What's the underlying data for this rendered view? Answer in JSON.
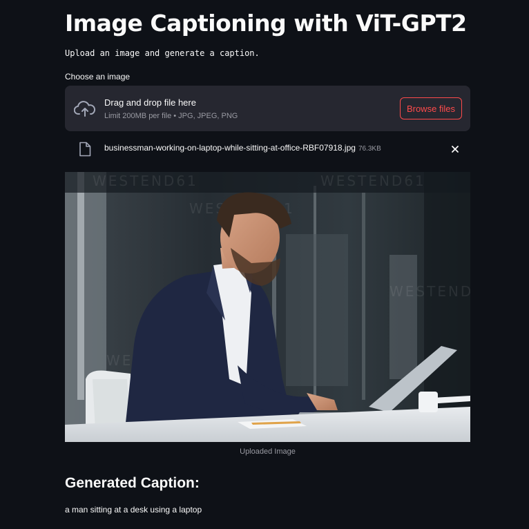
{
  "page": {
    "title": "Image Captioning with ViT-GPT2",
    "subtitle": "Upload an image and generate a caption."
  },
  "uploader": {
    "label": "Choose an image",
    "drop_text": "Drag and drop file here",
    "limit_text": "Limit 200MB per file • JPG, JPEG, PNG",
    "browse_label": "Browse files",
    "icon": "cloud-upload-icon"
  },
  "uploaded_file": {
    "name": "businessman-working-on-laptop-while-sitting-at-office-RBF07918.jpg",
    "size": "76.3KB",
    "icon": "file-icon",
    "remove_icon": "close-icon"
  },
  "image": {
    "caption": "Uploaded Image",
    "watermark": "WESTEND61"
  },
  "result": {
    "heading": "Generated Caption:",
    "text": "a man sitting at a desk using a laptop"
  },
  "colors": {
    "background": "#0e1117",
    "panel": "#262730",
    "accent": "#ff4b4b",
    "text": "#fafafa",
    "muted": "#9a9ba3"
  }
}
